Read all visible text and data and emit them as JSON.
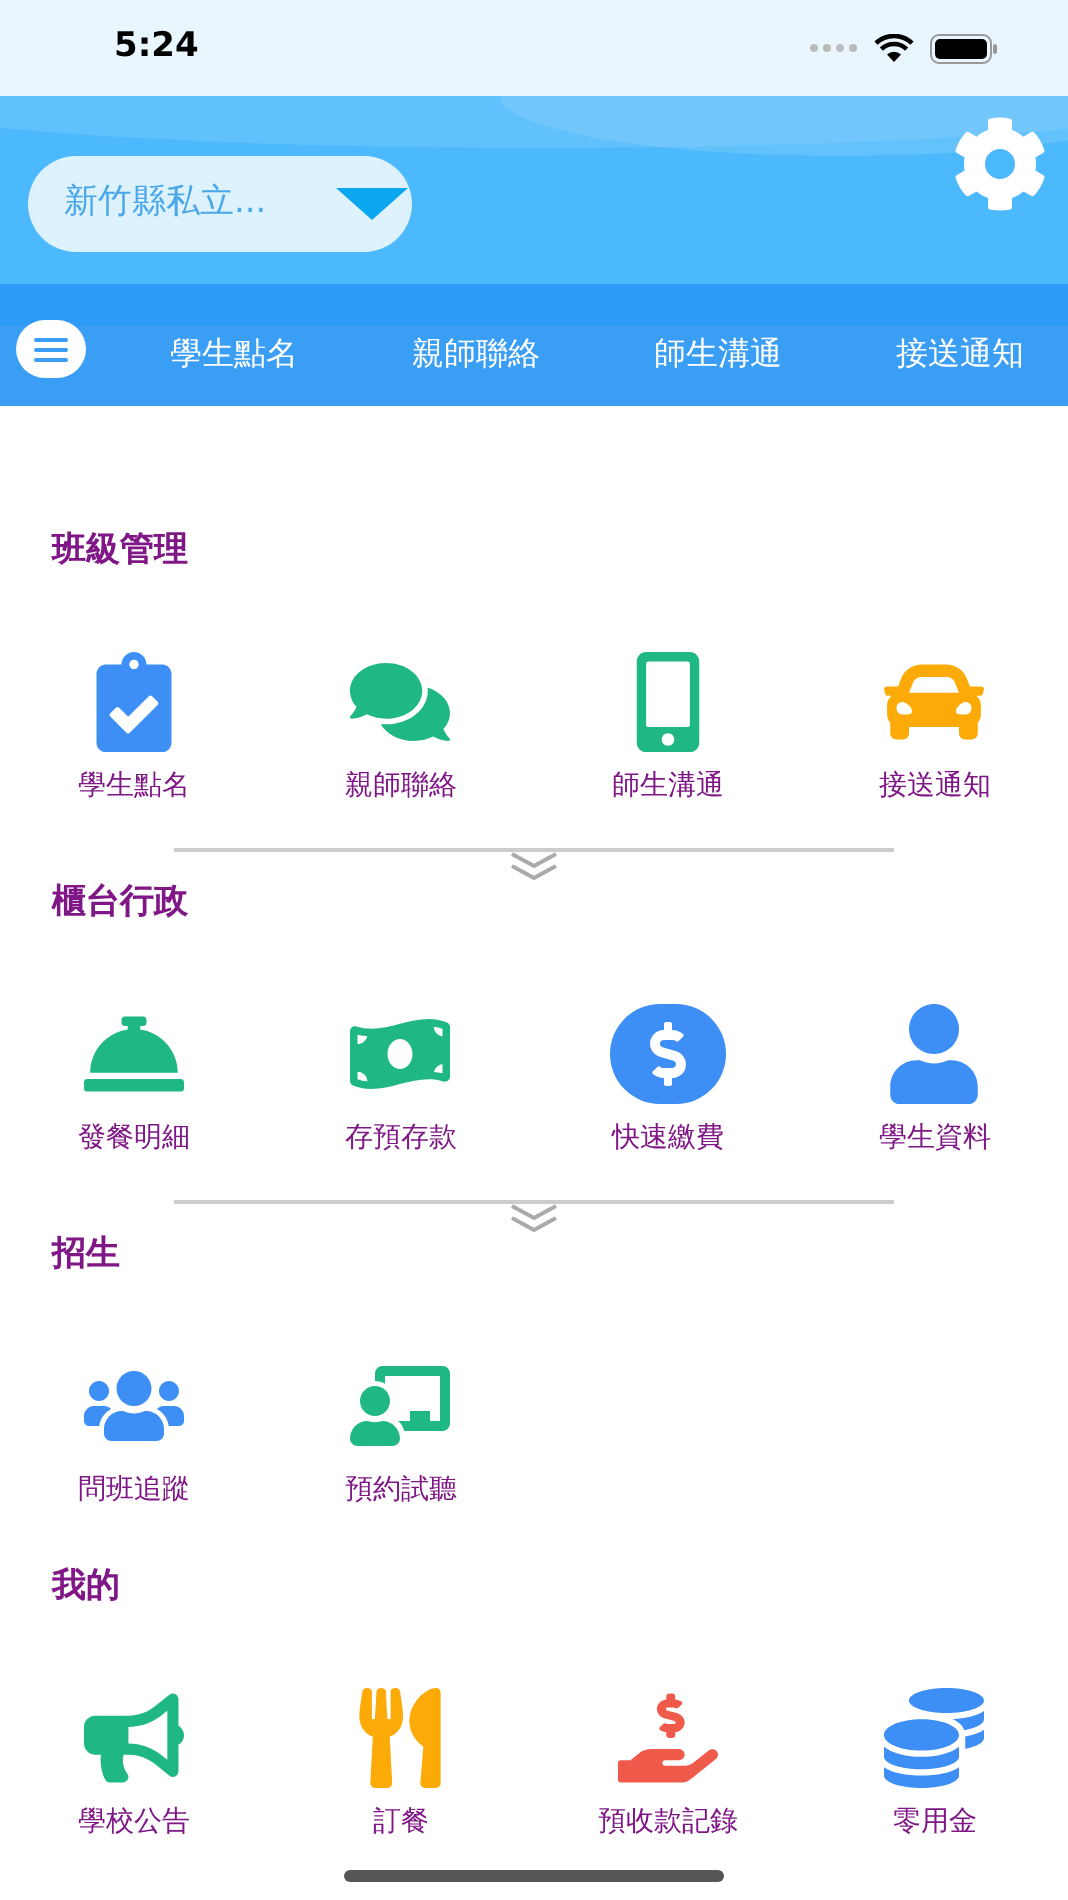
{
  "status_bar": {
    "time": "5:24"
  },
  "header": {
    "school_picker": {
      "value": "新竹縣私立..."
    }
  },
  "nav_tabs": [
    "學生點名",
    "親師聯絡",
    "師生溝通",
    "接送通知"
  ],
  "sections": [
    {
      "title": "班級管理",
      "has_more": true,
      "items": [
        "學生點名",
        "親師聯絡",
        "師生溝通",
        "接送通知"
      ]
    },
    {
      "title": "櫃台行政",
      "has_more": true,
      "items": [
        "發餐明細",
        "存預存款",
        "快速繳費",
        "學生資料"
      ]
    },
    {
      "title": "招生",
      "has_more": false,
      "items": [
        "問班追蹤",
        "預約試聽"
      ]
    },
    {
      "title": "我的",
      "has_more": false,
      "items": [
        "學校公告",
        "訂餐",
        "預收款記錄",
        "零用金"
      ]
    }
  ]
}
